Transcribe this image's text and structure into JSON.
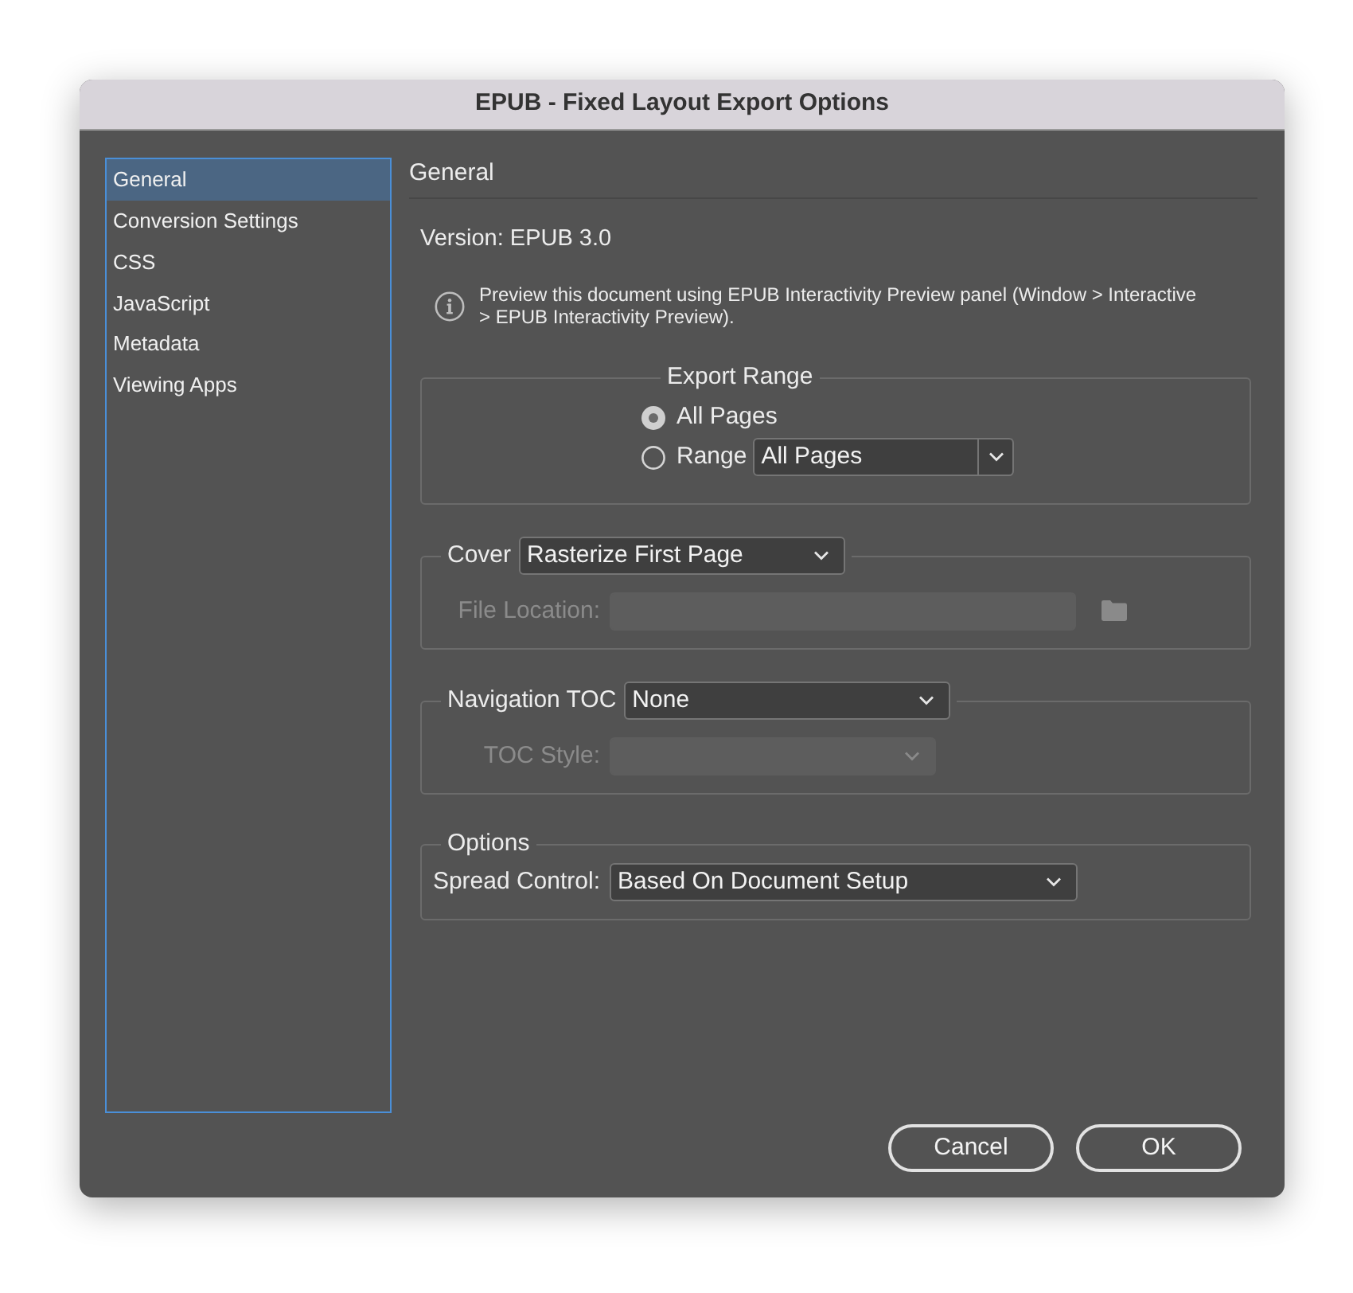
{
  "window": {
    "title": "EPUB - Fixed Layout Export Options"
  },
  "sidebar": {
    "items": [
      {
        "label": "General",
        "selected": true
      },
      {
        "label": "Conversion Settings",
        "selected": false
      },
      {
        "label": "CSS",
        "selected": false
      },
      {
        "label": "JavaScript",
        "selected": false
      },
      {
        "label": "Metadata",
        "selected": false
      },
      {
        "label": "Viewing Apps",
        "selected": false
      }
    ]
  },
  "panel": {
    "heading": "General",
    "version": "Version: EPUB 3.0",
    "info": "Preview this document using EPUB Interactivity Preview panel (Window > Interactive > EPUB Interactivity Preview)."
  },
  "export_range": {
    "title": "Export Range",
    "options": [
      {
        "label": "All Pages",
        "selected": true
      },
      {
        "label": "Range",
        "selected": false,
        "dropdown": "All Pages"
      }
    ]
  },
  "cover": {
    "label": "Cover",
    "value": "Rasterize First Page",
    "file_location": {
      "label": "File Location:",
      "disabled": true
    }
  },
  "navigation_toc": {
    "label": "Navigation TOC",
    "value": "None",
    "toc_style": {
      "label": "TOC Style:",
      "disabled": true
    }
  },
  "options": {
    "title": "Options",
    "spread_control": {
      "label": "Spread Control:",
      "value": "Based On Document Setup"
    }
  },
  "buttons": [
    {
      "label": "Cancel"
    },
    {
      "label": "OK"
    }
  ]
}
